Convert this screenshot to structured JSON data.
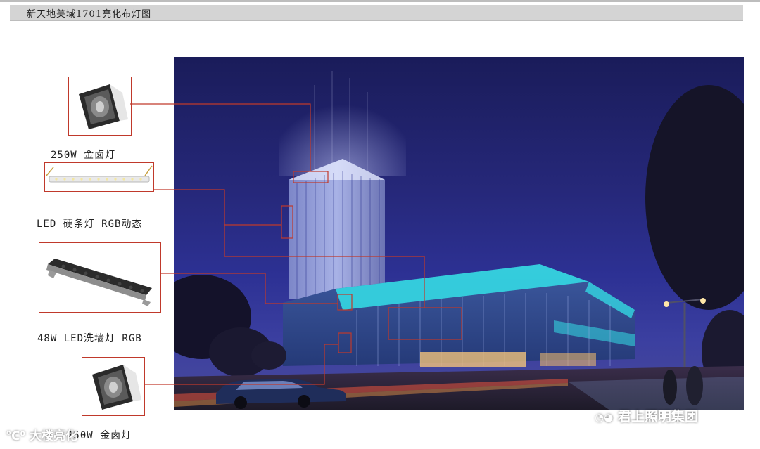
{
  "page": {
    "title": "新天地美域1701亮化布灯图"
  },
  "fixtures": [
    {
      "label": "250W  金卤灯",
      "kind": "floodlight"
    },
    {
      "label": "LED  硬条灯  RGB动态",
      "kind": "led-hard-strip"
    },
    {
      "label": "48W  LED洗墙灯  RGB",
      "kind": "led-wall-washer"
    },
    {
      "label": "250W  金卤灯",
      "kind": "floodlight"
    }
  ],
  "watermarks": {
    "left": "大楼亮化",
    "right": "君上照明集团"
  },
  "colors": {
    "leader_line": "#c0392b",
    "sky": "#26287a",
    "facade_glow": "#34e0e8"
  }
}
